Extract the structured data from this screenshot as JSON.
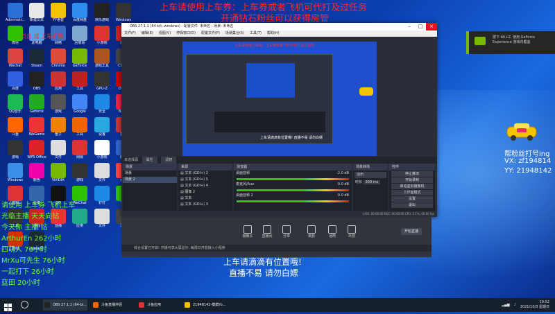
{
  "desktop": {
    "icons": [
      {
        "label": "Administr...",
        "color": "#2a6fd6"
      },
      {
        "label": "新建文本",
        "color": "#e8e8e8"
      },
      {
        "label": "YY语音",
        "color": "#f4c200"
      },
      {
        "label": "百度网盘",
        "color": "#2e8cf0"
      },
      {
        "label": "快乐游戏",
        "color": "#222"
      },
      {
        "label": "Windows",
        "color": "#333"
      },
      {
        "label": "微信",
        "color": "#2dc100"
      },
      {
        "label": "此电脑",
        "color": "#5aa0e8"
      },
      {
        "label": "网络",
        "color": "#3c6fc2"
      },
      {
        "label": "回收站",
        "color": "#7fa8d0"
      },
      {
        "label": "小游戏",
        "color": "#d33"
      },
      {
        "label": "游戏",
        "color": "#c22"
      },
      {
        "label": "Wechat",
        "color": "#d44"
      },
      {
        "label": "Steam",
        "color": "#1b2838"
      },
      {
        "label": "Chrome",
        "color": "#dd4b39"
      },
      {
        "label": "GeForce",
        "color": "#76b900"
      },
      {
        "label": "游戏工具",
        "color": "#a52"
      },
      {
        "label": "CPU-Z",
        "color": "#444"
      },
      {
        "label": "百度",
        "color": "#3060e0"
      },
      {
        "label": "OBS",
        "color": "#222"
      },
      {
        "label": "应用",
        "color": "#c33"
      },
      {
        "label": "工具",
        "color": "#b22"
      },
      {
        "label": "GPU-Z",
        "color": "#333"
      },
      {
        "label": "Office",
        "color": "#c00"
      },
      {
        "label": "QQ音乐",
        "color": "#1db954"
      },
      {
        "label": "Geforce",
        "color": "#2a2"
      },
      {
        "label": "游戏",
        "color": "#555"
      },
      {
        "label": "Google",
        "color": "#4285f4"
      },
      {
        "label": "安全",
        "color": "#1e88e5"
      },
      {
        "label": "Baidu",
        "color": "#e24"
      },
      {
        "label": "斗鱼",
        "color": "#f60"
      },
      {
        "label": "WeGame",
        "color": "#e33"
      },
      {
        "label": "橙子",
        "color": "#f08000"
      },
      {
        "label": "工具",
        "color": "#e60"
      },
      {
        "label": "设置",
        "color": "#29a8e0"
      },
      {
        "label": "直播",
        "color": "#c33"
      },
      {
        "label": "游戏",
        "color": "#333"
      },
      {
        "label": "WPS Office",
        "color": "#d22"
      },
      {
        "label": "文件",
        "color": "#ddd"
      },
      {
        "label": "网易",
        "color": "#d33"
      },
      {
        "label": "小游戏",
        "color": "#fff"
      },
      {
        "label": "腾讯",
        "color": "#36c"
      },
      {
        "label": "Windows",
        "color": "#3a8ee6"
      },
      {
        "label": "颜色",
        "color": "#e0a"
      },
      {
        "label": "NVIDIA",
        "color": "#76b900"
      },
      {
        "label": "游戏",
        "color": "#333"
      },
      {
        "label": "文件",
        "color": "#ddd"
      },
      {
        "label": "百度",
        "color": "#f44"
      },
      {
        "label": "游戏",
        "color": "#d33"
      },
      {
        "label": "设备",
        "color": "#36a"
      },
      {
        "label": "QQ",
        "color": "#111"
      },
      {
        "label": "WeChat",
        "color": "#2dc100"
      },
      {
        "label": "钉钉",
        "color": "#1e88e5"
      },
      {
        "label": "TIM",
        "color": "#2dc100"
      },
      {
        "label": "工具",
        "color": "#333"
      },
      {
        "label": "游戏",
        "color": "#c22"
      },
      {
        "label": "直播",
        "color": "#e33"
      },
      {
        "label": "应用",
        "color": "#2a8"
      },
      {
        "label": "文件",
        "color": "#ddd"
      },
      {
        "label": "工具",
        "color": "#444"
      },
      {
        "label": "游戏",
        "color": "#c30"
      },
      {
        "label": "Steam",
        "color": "#1b2838"
      }
    ]
  },
  "overlay": {
    "top_line1": "上车请使用上车券：上车券或者飞机可代打及过任务",
    "top_line2": "开通钻石粉丝可以获得房管",
    "left_red": "点击  成  上车新路",
    "left_green": [
      {
        "text": "请使用 上车券 飞机上车"
      },
      {
        "text": "光临主播 天天向钻"
      },
      {
        "text": "今天你 主播 钻"
      },
      {
        "text": "ArthurEn         262小时"
      },
      {
        "text": "四萌人          76小时"
      },
      {
        "text": "MrXu可先生        76小时"
      },
      {
        "text": "一起打下        26小时"
      },
      {
        "text": "蓝田         20小时"
      }
    ],
    "right_fans": "帮粉丝打号ing",
    "vx": "VX:  zf194814",
    "yy": "YY:  21948142",
    "bottom_line1": "上车请滴滴有位置哦!",
    "bottom_line2": "直播不易 请勿白嫖"
  },
  "obs": {
    "title": "OBS 27.1.1 (64-bit, windows) - 配置文件: 未命名 - 场景: 未命名",
    "menu": [
      "文件(F)",
      "编辑(E)",
      "视图(V)",
      "停靠窗口(D)",
      "配置文件(P)",
      "场景集合(S)",
      "工具(T)",
      "帮助(H)"
    ],
    "preview_red": "上车请使用上车券：上车券或者飞机可代打及过任务",
    "preview_white": "上车请滴滴有位置哦! 直播不易 请勿白嫖",
    "strip_label": "未选择源",
    "tab_props": "属性",
    "tab_filters": "滤镜",
    "docks": {
      "scenes": {
        "title": "场景",
        "items": [
          "场景",
          "场景 2"
        ]
      },
      "sources": {
        "title": "来源",
        "items": [
          "文本 (GDI+) 2",
          "文本 (GDI+) 5",
          "文本 (GDI+) 4",
          "图像 2",
          "文本",
          "文本 (GDI+) 3"
        ]
      },
      "mixer": {
        "title": "混音器",
        "channels": [
          {
            "name": "桌面音频",
            "db": "-2.0 dB"
          },
          {
            "name": "麦克风/Aux",
            "db": "0.0 dB"
          },
          {
            "name": "桌面音频 2",
            "db": "0.0 dB"
          }
        ]
      },
      "transitions": {
        "title": "场景转场",
        "mode": "淡出",
        "duration_label": "时长",
        "duration": "300 ms"
      },
      "controls": {
        "title": "控件",
        "buttons": [
          "停止推流",
          "开始录制",
          "启动虚拟摄像机",
          "工作室模式",
          "设置",
          "退出"
        ]
      }
    },
    "status": "LIVE: 00:00:00    REC: 00:00:00    CPU: 2.1%, 60.00 fps"
  },
  "app2": {
    "notice": "综合设置已开启! 开播可享大屏显示, 每周日开放接入小程序",
    "buttons": [
      "摄像头",
      "直播间",
      "分享",
      "美颜",
      "话筒",
      "外放"
    ],
    "start": "开始直播"
  },
  "nvidia": {
    "line1": "按下 Alt+Z, 使用 GeForce",
    "line2": "Experience 游戏内覆盖"
  },
  "taskbar": {
    "items": [
      {
        "label": "OBS 27.1.1 (64-bi...",
        "color": "#222"
      },
      {
        "label": "斗鱼直播伴侣",
        "color": "#f60"
      },
      {
        "label": "斗鱼应用",
        "color": "#d33"
      },
      {
        "label": "21948142-摸摸Yo...",
        "color": "#f4c200"
      }
    ],
    "time": "19:52",
    "date": "2021/10/3 星期日"
  }
}
